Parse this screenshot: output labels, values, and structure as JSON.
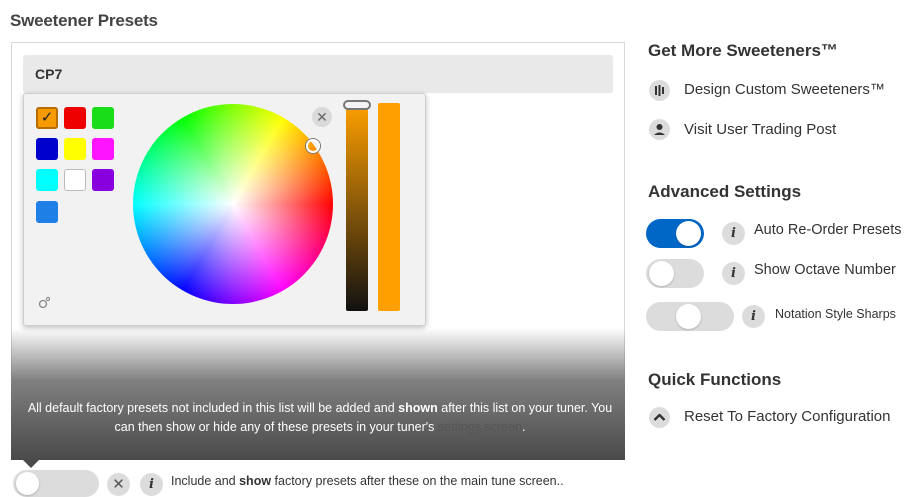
{
  "page_title": "Sweetener Presets",
  "preset": {
    "name": "CP7"
  },
  "picker": {
    "swatches": [
      "#f59b00",
      "#ef0000",
      "#18dd18",
      "#0000cc",
      "#ffff00",
      "#ff14ff",
      "#00ffff",
      "#ffffff",
      "#8800dd",
      "#1e7fe6"
    ],
    "selected_check": "✓",
    "close_glyph": "✕",
    "slider_value_color": "#ffa000"
  },
  "notice": {
    "part1": "All default factory presets not included in this list will be added and ",
    "bold": "shown",
    "part2": " after this list on your tuner. You can then show or hide any of these presets in your tuner's ",
    "link": "settings screen",
    "end": "."
  },
  "bottom": {
    "label_pre": "Include and ",
    "label_bold": "show",
    "label_post": " factory presets after these on the main tune screen..",
    "x_glyph": "✕",
    "info_glyph": "i",
    "toggle_on": false
  },
  "sidebar": {
    "more_title": "Get More Sweeteners™",
    "design_label": "Design Custom Sweeteners™",
    "design_icon": "bars-icon",
    "trading_label": "Visit User Trading Post",
    "trading_icon": "person-icon",
    "advanced_title": "Advanced Settings",
    "settings": [
      {
        "label": "Auto Re-Order Presets",
        "on": true
      },
      {
        "label": "Show Octave Number",
        "on": false
      },
      {
        "label": "Notation Style Sharps",
        "state": "middle"
      }
    ],
    "quick_title": "Quick Functions",
    "reset_label": "Reset To Factory Configuration",
    "reset_icon": "chevron-up-icon"
  },
  "colors": {
    "accent_blue": "#0067c6",
    "orange": "#ffa000"
  }
}
